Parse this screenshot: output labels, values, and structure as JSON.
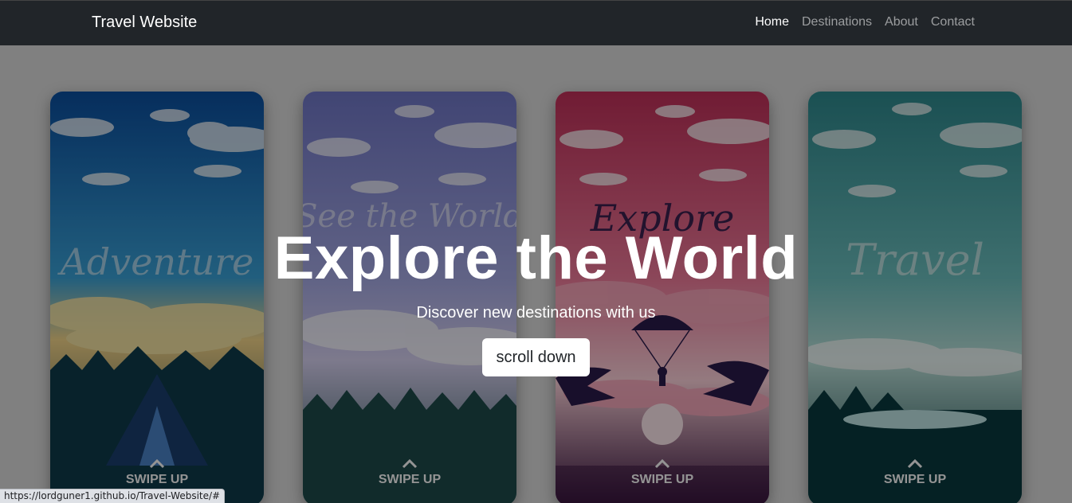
{
  "navbar": {
    "brand": "Travel Website",
    "links": [
      {
        "label": "Home",
        "active": true
      },
      {
        "label": "Destinations",
        "active": false
      },
      {
        "label": "About",
        "active": false
      },
      {
        "label": "Contact",
        "active": false
      }
    ]
  },
  "hero": {
    "title": "Explore the World",
    "subtitle": "Discover new destinations with us",
    "button_label": "scroll down"
  },
  "cards": [
    {
      "title": "Adventure",
      "cta": "SWIPE UP",
      "icon": "tent-icon",
      "colors": {
        "sky_top": "#0b4fa0",
        "sky_mid": "#3aa3d9",
        "horizon": "#f6d78a",
        "ground": "#0c2e3a"
      }
    },
    {
      "title": "See the World",
      "cta": "SWIPE UP",
      "icon": "forest-icon",
      "colors": {
        "sky_top": "#7077c8",
        "sky_mid": "#a6aae6",
        "horizon": "#d8d2f2",
        "ground": "#1e4a4a"
      }
    },
    {
      "title": "Explore",
      "cta": "SWIPE UP",
      "icon": "parachute-icon",
      "colors": {
        "sky_top": "#c2305a",
        "sky_mid": "#f07a9a",
        "horizon": "#ffd3dc",
        "ground": "#3a1540"
      }
    },
    {
      "title": "Travel",
      "cta": "SWIPE UP",
      "icon": "lake-icon",
      "colors": {
        "sky_top": "#2e8a8f",
        "sky_mid": "#6cc0bf",
        "horizon": "#bde3dc",
        "ground": "#0a3a3e"
      }
    }
  ],
  "status_bar": {
    "url": "https://lordguner1.github.io/Travel-Website/#"
  }
}
